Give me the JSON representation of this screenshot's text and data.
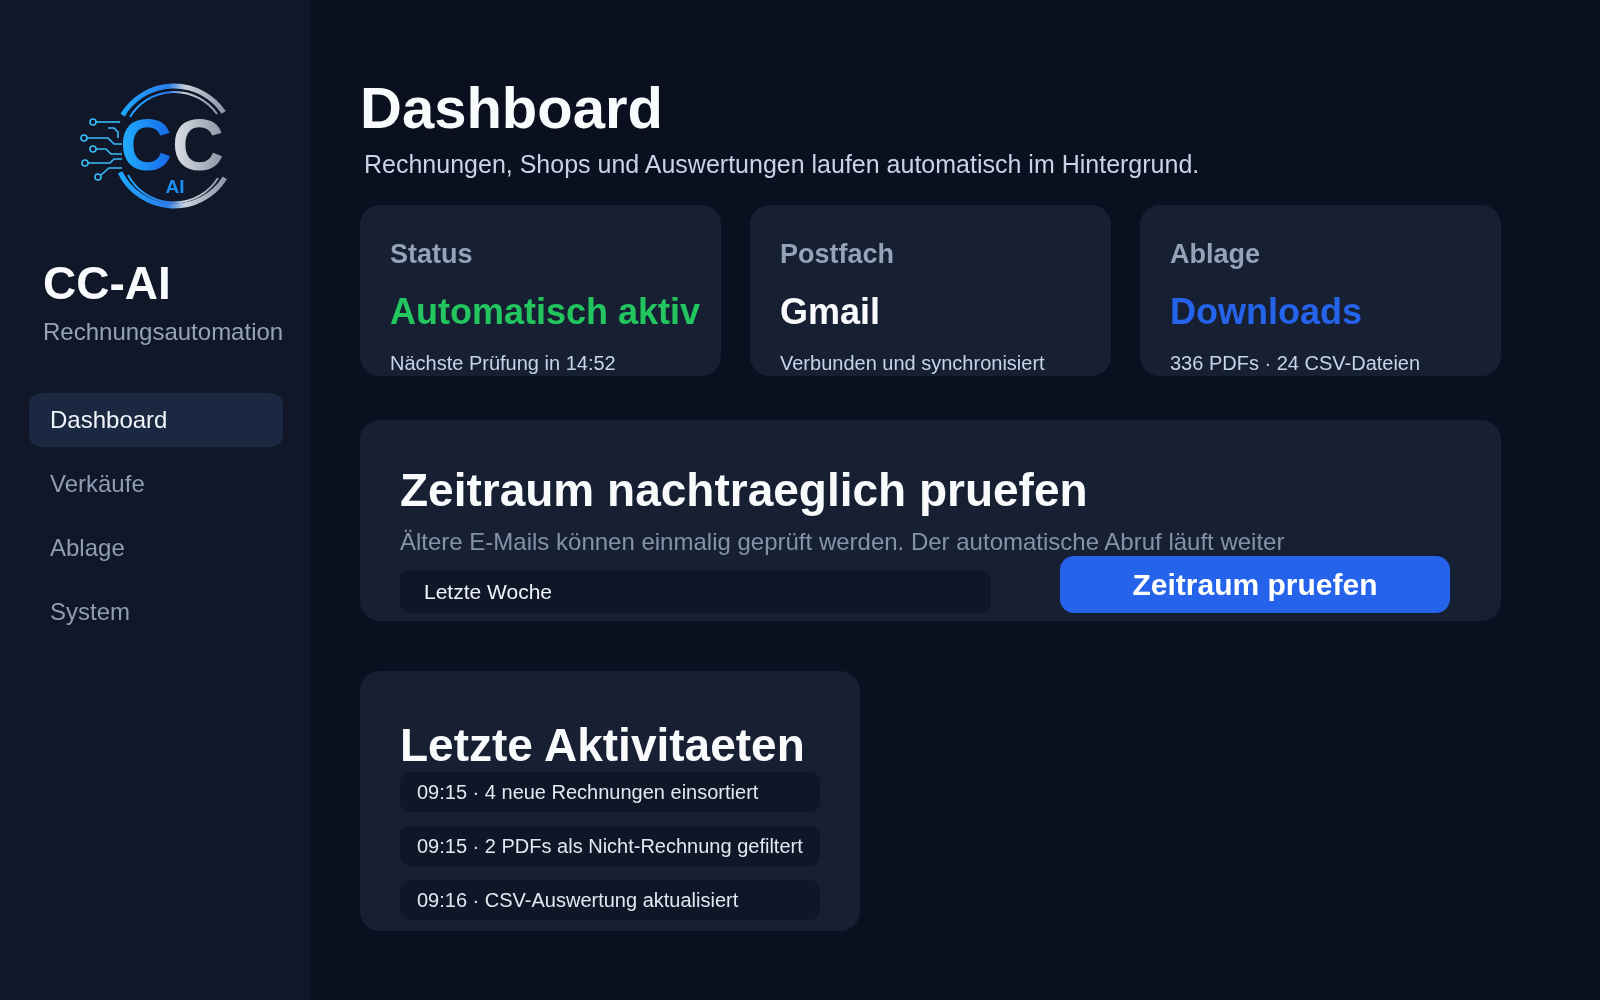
{
  "sidebar": {
    "logo": {
      "letters": "CC",
      "subtext": "AI"
    },
    "app_name": "CC-AI",
    "app_subtitle": "Rechnungsautomation",
    "nav": [
      {
        "label": "Dashboard",
        "selected": true
      },
      {
        "label": "Verkäufe",
        "selected": false
      },
      {
        "label": "Ablage",
        "selected": false
      },
      {
        "label": "System",
        "selected": false
      }
    ]
  },
  "header": {
    "title": "Dashboard",
    "subtitle": "Rechnungen, Shops und Auswertungen laufen automatisch im Hintergrund."
  },
  "stat_cards": [
    {
      "label": "Status",
      "value": "Automatisch aktiv",
      "detail": "Nächste Prüfung in 14:52",
      "color": "#22c55e"
    },
    {
      "label": "Postfach",
      "value": "Gmail",
      "detail": "Verbunden und synchronisiert",
      "color": "#f8fafc"
    },
    {
      "label": "Ablage",
      "value": "Downloads",
      "detail": "336 PDFs · 24 CSV-Dateien",
      "color": "#2563eb"
    }
  ],
  "range_check": {
    "title": "Zeitraum nachtraeglich pruefen",
    "description": "Ältere E-Mails können einmalig geprüft werden. Der automatische Abruf läuft weiter",
    "period_field": {
      "value": "Letzte Woche"
    },
    "button": "Zeitraum pruefen"
  },
  "activity": {
    "title": "Letzte Aktivitaeten",
    "items": [
      "09:15 · 4 neue Rechnungen einsortiert",
      "09:15 · 2 PDFs als Nicht-Rechnung gefiltert",
      "09:16 · CSV-Auswertung aktualisiert"
    ]
  }
}
